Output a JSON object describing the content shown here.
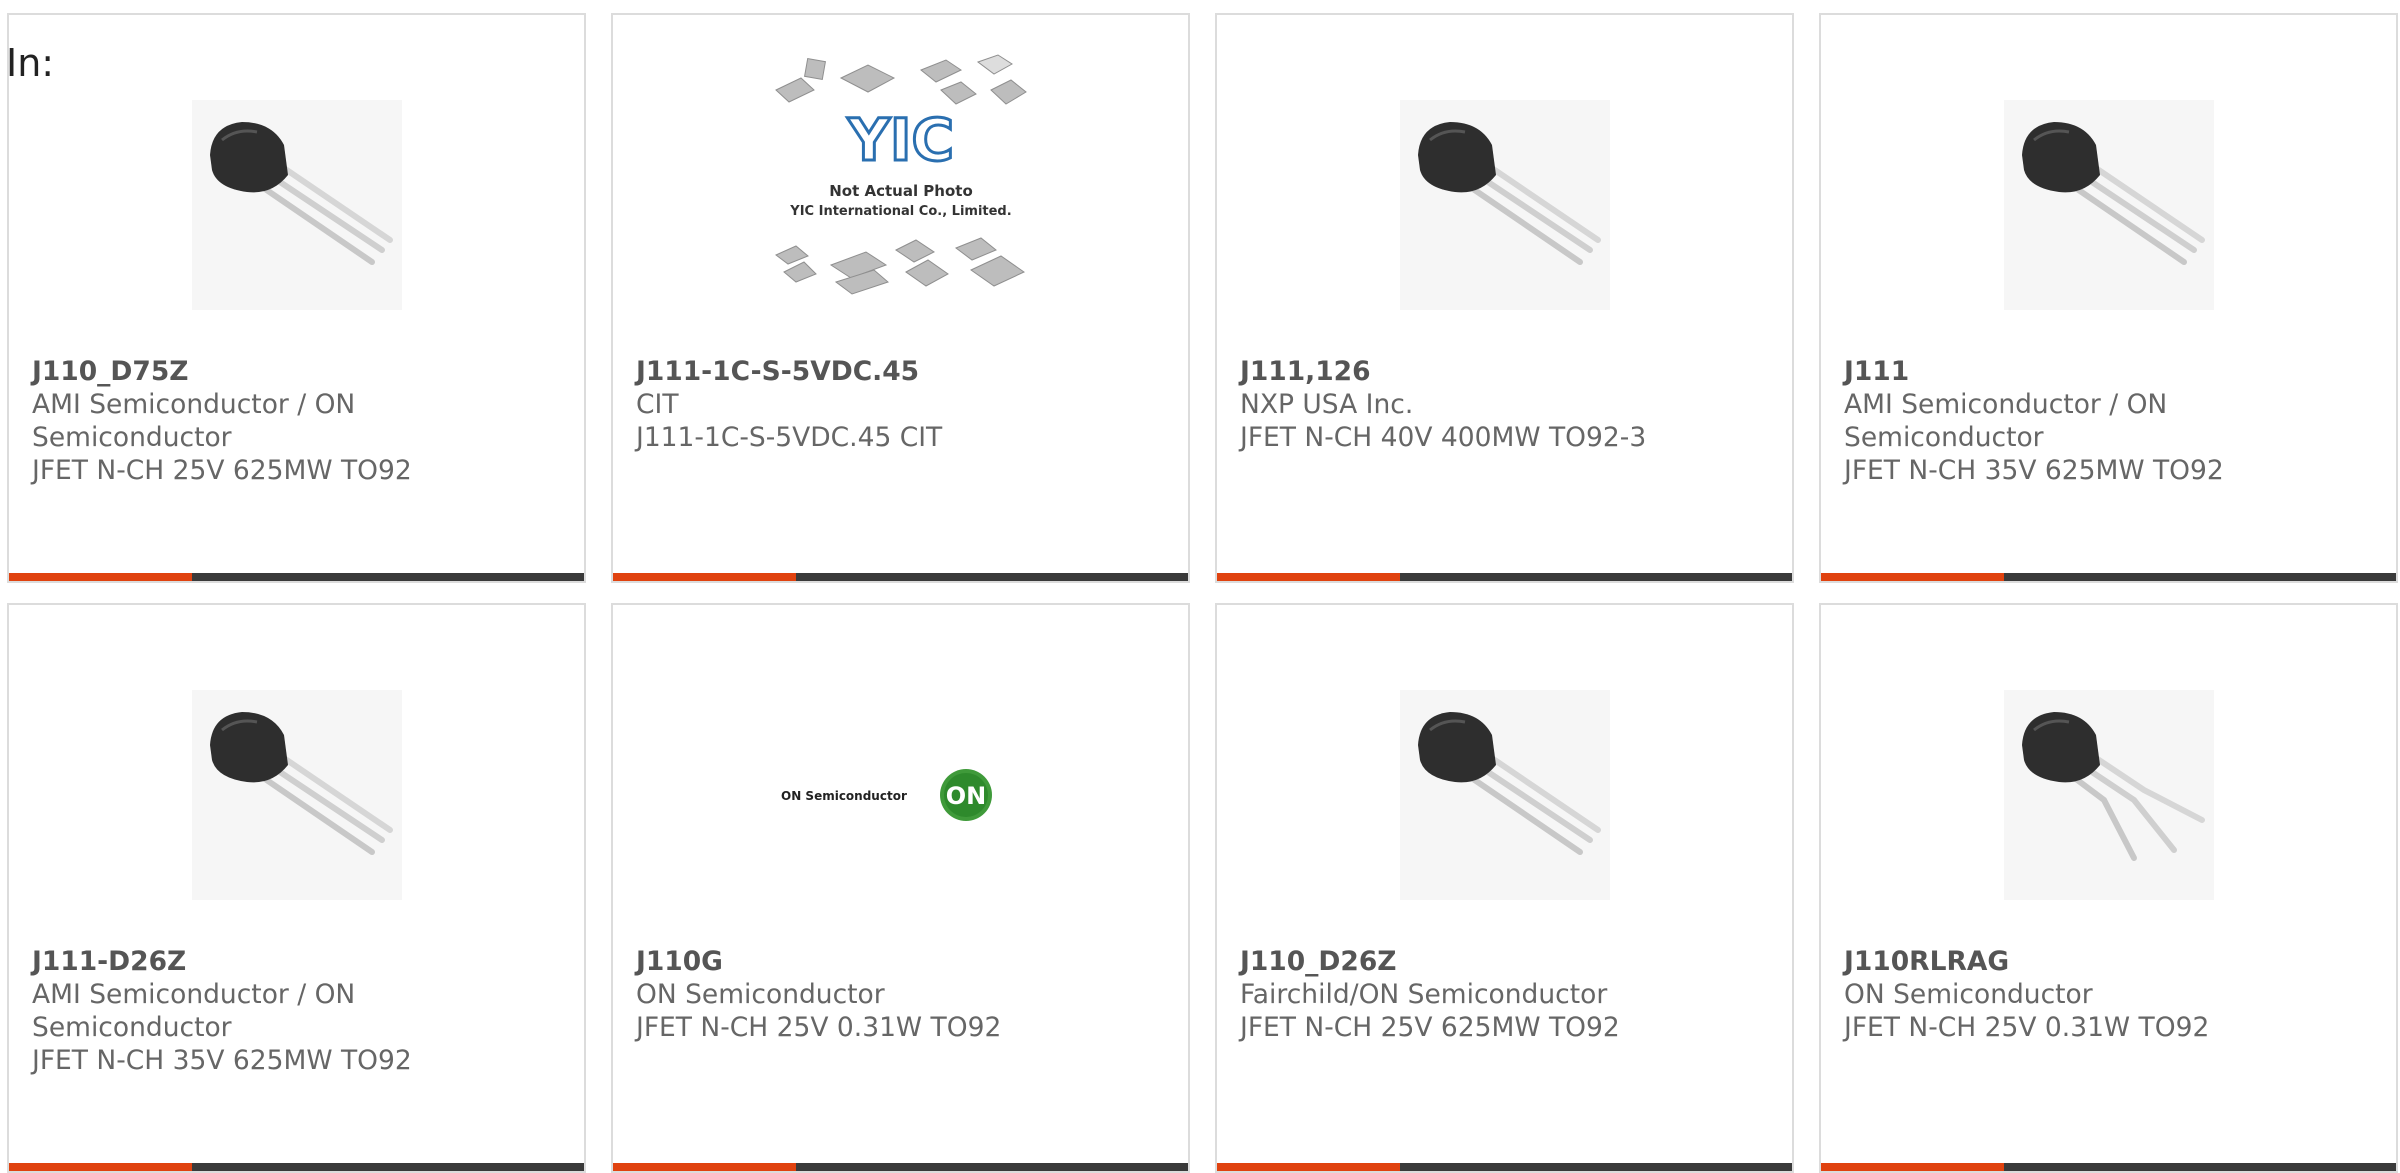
{
  "header": {
    "in_label": "In:"
  },
  "products": [
    {
      "part": "J110_D75Z",
      "manufacturer_line1": "AMI Semiconductor / ON",
      "manufacturer_line2": "Semiconductor",
      "description": "JFET N-CH 25V 625MW TO92",
      "image": "to92-transistor-icon"
    },
    {
      "part": "J111-1C-S-5VDC.45",
      "manufacturer_line1": "CIT",
      "manufacturer_line2": "",
      "description": "J111-1C-S-5VDC.45 CIT",
      "image": "yic-placeholder-icon",
      "placeholder": {
        "logo": "YIC",
        "caption1": "Not Actual Photo",
        "caption2": "YIC International Co., Limited."
      }
    },
    {
      "part": "J111,126",
      "manufacturer_line1": "NXP USA Inc.",
      "manufacturer_line2": "",
      "description": "JFET N-CH 40V 400MW TO92-3",
      "image": "to92-transistor-icon"
    },
    {
      "part": "J111",
      "manufacturer_line1": "AMI Semiconductor / ON",
      "manufacturer_line2": "Semiconductor",
      "description": "JFET N-CH 35V 625MW TO92",
      "image": "to92-transistor-icon"
    },
    {
      "part": "J111-D26Z",
      "manufacturer_line1": "AMI Semiconductor / ON",
      "manufacturer_line2": "Semiconductor",
      "description": "JFET N-CH 35V 625MW TO92",
      "image": "to92-transistor-icon"
    },
    {
      "part": "J110G",
      "manufacturer_line1": "ON Semiconductor",
      "manufacturer_line2": "",
      "description": "JFET N-CH 25V 0.31W TO92",
      "image": "on-semi-logo-icon",
      "logo": {
        "text": "ON Semiconductor",
        "badge": "ON"
      }
    },
    {
      "part": "J110_D26Z",
      "manufacturer_line1": "Fairchild/ON Semiconductor",
      "manufacturer_line2": "",
      "description": "JFET N-CH 25V 625MW TO92",
      "image": "to92-transistor-icon"
    },
    {
      "part": "J110RLRAG",
      "manufacturer_line1": "ON Semiconductor",
      "manufacturer_line2": "",
      "description": "JFET N-CH 25V 0.31W TO92",
      "image": "to92-bent-transistor-icon"
    }
  ],
  "colors": {
    "accent": "#e0420f",
    "bar": "#3a3a3a",
    "border": "#dcdcdc",
    "text": "#666666"
  }
}
